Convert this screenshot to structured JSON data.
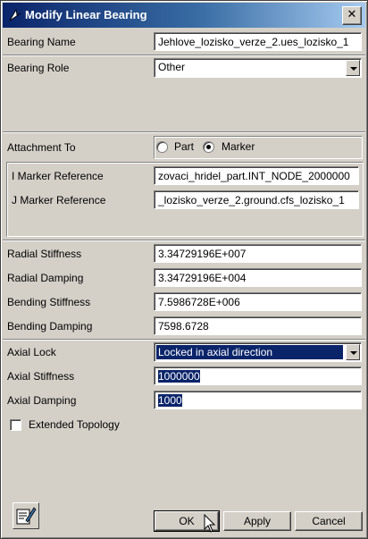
{
  "window": {
    "title": "Modify Linear Bearing",
    "close_glyph": "✕"
  },
  "fields": {
    "bearing_name": {
      "label": "Bearing Name",
      "value": "Jehlove_lozisko_verze_2.ues_lozisko_1"
    },
    "bearing_role": {
      "label": "Bearing Role",
      "value": "Other"
    },
    "attachment": {
      "label": "Attachment To",
      "options": [
        "Part",
        "Marker"
      ],
      "selected": "Marker"
    },
    "i_marker": {
      "label": "I Marker Reference",
      "value": "zovaci_hridel_part.INT_NODE_2000000"
    },
    "j_marker": {
      "label": "J Marker Reference",
      "value": "_lozisko_verze_2.ground.cfs_lozisko_1"
    },
    "radial_stiffness": {
      "label": "Radial Stiffness",
      "value": "3.34729196E+007"
    },
    "radial_damping": {
      "label": "Radial Damping",
      "value": "3.34729196E+004"
    },
    "bending_stiffness": {
      "label": "Bending Stiffness",
      "value": "7.5986728E+006"
    },
    "bending_damping": {
      "label": "Bending Damping",
      "value": "7598.6728"
    },
    "axial_lock": {
      "label": "Axial Lock",
      "value": "Locked in axial direction"
    },
    "axial_stiffness": {
      "label": "Axial Stiffness",
      "value": "1000000"
    },
    "axial_damping": {
      "label": "Axial Damping",
      "value": "1000"
    },
    "extended_topology": {
      "label": "Extended Topology",
      "checked": false
    }
  },
  "buttons": {
    "ok": "OK",
    "apply": "Apply",
    "cancel": "Cancel"
  },
  "icons": {
    "title": "app-cursor-icon",
    "tool": "edit-notes-icon"
  },
  "colors": {
    "title_start": "#0a246a",
    "title_end": "#a6caf0",
    "selection": "#0a246a",
    "face": "#d4d0c8"
  }
}
